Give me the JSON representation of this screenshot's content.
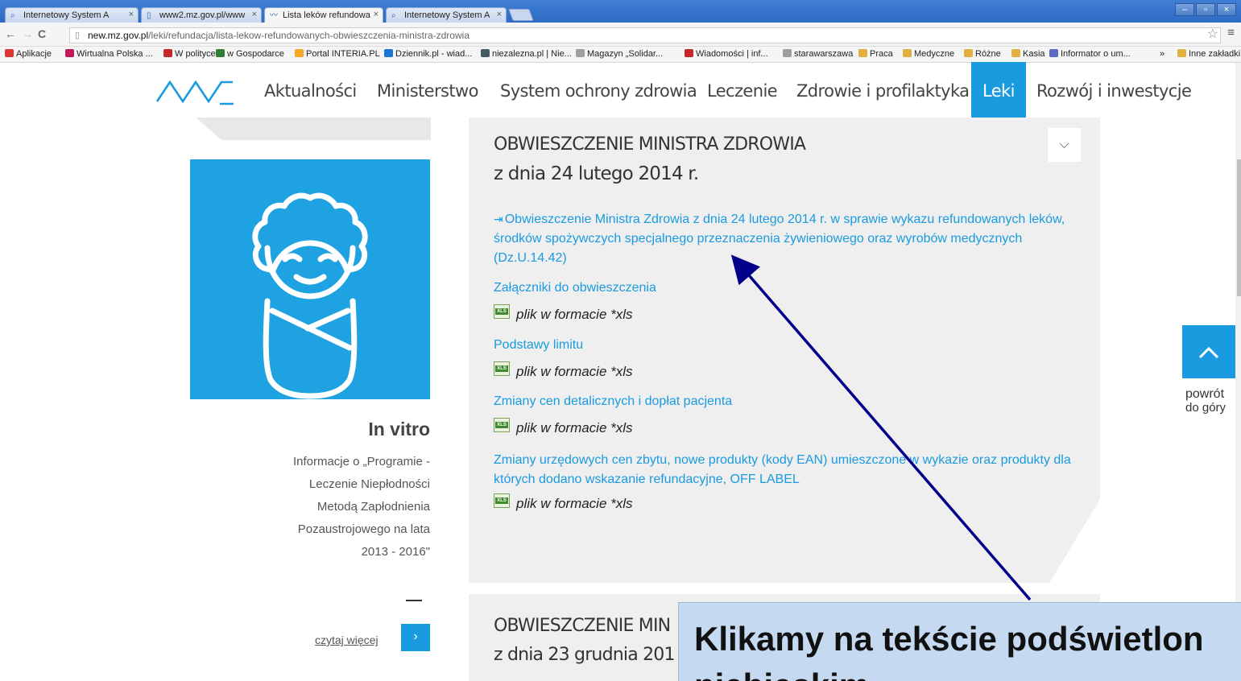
{
  "browser": {
    "tabs": [
      {
        "label": "Internetowy System A",
        "icon": "search-icon"
      },
      {
        "label": "www2.mz.gov.pl/www",
        "icon": "document-icon"
      },
      {
        "label": "Lista leków refundowa",
        "icon": "mz-logo-icon"
      },
      {
        "label": "Internetowy System A",
        "icon": "search-icon"
      }
    ],
    "url_host": "new.mz.gov.pl",
    "url_path": "/leki/refundacja/lista-lekow-refundowanych-obwieszczenia-ministra-zdrowia",
    "bookmarks": [
      {
        "label": "Aplikacje",
        "color": "#d33"
      },
      {
        "label": "Wirtualna Polska ...",
        "color": "#c2185b"
      },
      {
        "label": "W polityce",
        "color": "#c62828"
      },
      {
        "label": "w Gospodarce",
        "color": "#2e7d32"
      },
      {
        "label": "Portal INTERIA.PL",
        "color": "#f9a825"
      },
      {
        "label": "Dziennik.pl - wiad...",
        "color": "#1976d2"
      },
      {
        "label": "niezalezna.pl | Nie...",
        "color": "#455a64"
      },
      {
        "label": "Magazyn „Solidar...",
        "color": "#9e9e9e"
      },
      {
        "label": "Wiadomości | inf...",
        "color": "#c62828"
      },
      {
        "label": "starawarszawa",
        "color": "#9e9e9e"
      },
      {
        "label": "Praca",
        "color": "#e0b040"
      },
      {
        "label": "Medyczne",
        "color": "#e0b040"
      },
      {
        "label": "Różne",
        "color": "#e0b040"
      },
      {
        "label": "Kasia",
        "color": "#e0b040"
      },
      {
        "label": "Informator o um...",
        "color": "#5c6bc0"
      }
    ],
    "bookmarks_more": "»",
    "other_bookmarks": "Inne zakładki"
  },
  "nav": {
    "items": [
      "Aktualności",
      "Ministerstwo",
      "System ochrony zdrowia",
      "Leczenie",
      "Zdrowie i profilaktyka",
      "Leki",
      "Rozwój i inwestycje"
    ],
    "active": "Leki"
  },
  "sidebar": {
    "title": "In vitro",
    "description": "Informacje o „Programie - Leczenie Niepłodności Metodą Zapłodnienia Pozaustrojowego na lata 2013 - 2016\"",
    "read_more": "czytaj więcej",
    "read_more_btn": "›"
  },
  "notice1": {
    "title": "OBWIESZCZENIE MINISTRA ZDROWIA",
    "date": "z dnia 24 lutego 2014 r.",
    "main_link": "Obwieszczenie Ministra Zdrowia z dnia 24 lutego 2014 r. w sprawie wykazu refundowanych leków, środków spożywczych specjalnego przeznaczenia żywieniowego oraz wyrobów medycznych (Dz.U.14.42)",
    "items": [
      {
        "label": "Załączniki do obwieszczenia",
        "file": "plik w formacie *xls"
      },
      {
        "label": "Podstawy limitu",
        "file": "plik w formacie *xls"
      },
      {
        "label": "Zmiany cen detalicznych i dopłat pacjenta",
        "file": "plik w formacie *xls"
      },
      {
        "label": "Zmiany urzędowych cen zbytu, nowe produkty (kody EAN) umieszczone w wykazie oraz produkty dla których dodano wskazanie refundacyjne, OFF LABEL",
        "file": "plik w formacie *xls"
      }
    ]
  },
  "notice2": {
    "title": "OBWIESZCZENIE MIN",
    "date": "z dnia 23 grudnia 201"
  },
  "back_to_top": {
    "line1": "powrót",
    "line2": "do góry"
  },
  "annotation": {
    "line1": "Klikamy na tekście podświetlon",
    "line2": "niebieskim"
  },
  "colors": {
    "accent": "#1a9be0",
    "arrow": "#00008b"
  }
}
